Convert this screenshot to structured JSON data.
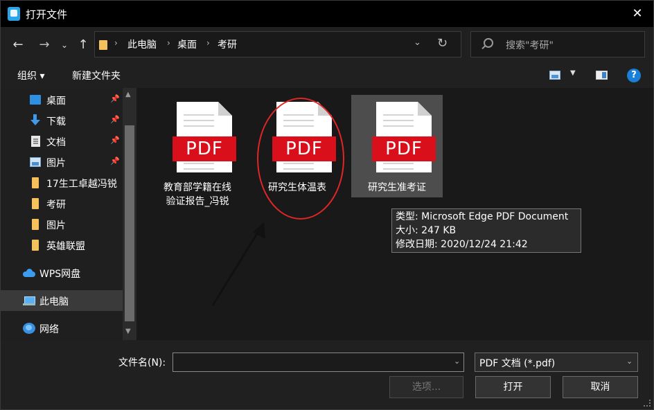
{
  "window": {
    "title": "打开文件",
    "close_glyph": "✕",
    "accent_color": "#1a7fd6"
  },
  "nav": {
    "back_glyph": "←",
    "forward_glyph": "→",
    "recent_glyph": "⌄",
    "up_glyph": "↑",
    "breadcrumbs": [
      "此电脑",
      "桌面",
      "考研"
    ],
    "separator_glyph": "›",
    "dropdown_glyph": "⌄",
    "refresh_glyph": "↻",
    "search_placeholder": "搜索\"考研\""
  },
  "toolbar": {
    "organize_label": "组织 ▾",
    "new_folder_label": "新建文件夹",
    "help_glyph": "?"
  },
  "sidebar": {
    "items": [
      {
        "label": "桌面",
        "icon": "desktop-icon",
        "pinned": true
      },
      {
        "label": "下载",
        "icon": "download-icon",
        "pinned": true
      },
      {
        "label": "文档",
        "icon": "document-icon",
        "pinned": true
      },
      {
        "label": "图片",
        "icon": "pictures-icon",
        "pinned": true
      },
      {
        "label": "17生工卓越冯锐",
        "icon": "folder-icon",
        "pinned": false
      },
      {
        "label": "考研",
        "icon": "folder-icon",
        "pinned": false
      },
      {
        "label": "图片",
        "icon": "folder-icon",
        "pinned": false
      },
      {
        "label": "英雄联盟",
        "icon": "folder-icon",
        "pinned": false
      },
      {
        "label": "WPS网盘",
        "icon": "cloud-icon",
        "pinned": false
      },
      {
        "label": "此电脑",
        "icon": "computer-icon",
        "pinned": false,
        "selected": true
      },
      {
        "label": "网络",
        "icon": "network-icon",
        "pinned": false
      }
    ],
    "pin_glyph": "📌"
  },
  "files": [
    {
      "name_line1": "教育部学籍在线",
      "name_line2": "验证报告_冯锐",
      "badge": "PDF"
    },
    {
      "name_line1": "研究生体温表",
      "name_line2": "",
      "badge": "PDF"
    },
    {
      "name_line1": "研究生准考证",
      "name_line2": "",
      "badge": "PDF",
      "hovered": true
    }
  ],
  "tooltip": {
    "type_line": "类型: Microsoft Edge PDF Document",
    "size_line": "大小: 247 KB",
    "modified_line": "修改日期: 2020/12/24 21:42"
  },
  "bottom": {
    "filename_label": "文件名",
    "filename_mnemonic": "(N)",
    "filename_colon": ":",
    "filename_value": "",
    "file_type_value": "PDF 文档 (*.pdf)",
    "options_label": "选项...",
    "open_label": "打开",
    "cancel_label": "取消"
  },
  "annotation": {
    "ellipse_color": "#e02626",
    "arrow_color": "#111111"
  }
}
